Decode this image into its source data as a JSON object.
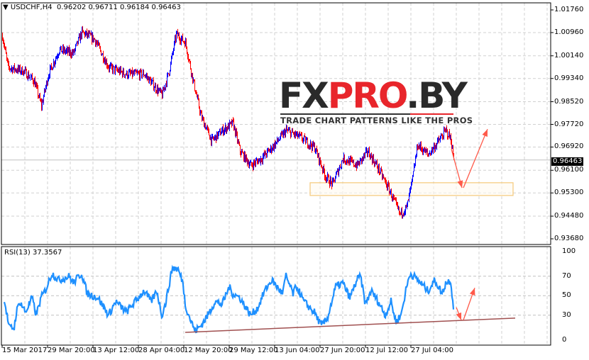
{
  "header": {
    "symbol": "USDCHF,H4",
    "ohlc": "0.96202 0.96711 0.96184 0.96463",
    "menu_icon": "triangle-down-icon"
  },
  "price_axis": {
    "labels": [
      "1.01760",
      "1.00960",
      "1.00140",
      "0.99340",
      "0.98520",
      "0.97720",
      "0.96920",
      "0.96100",
      "0.95300",
      "0.94480",
      "0.93680"
    ],
    "current": "0.96463"
  },
  "rsi": {
    "title": "RSI(13) 37.3567",
    "labels": [
      "100",
      "70",
      "50",
      "30",
      "0"
    ]
  },
  "time_axis": {
    "labels": [
      "15 Mar 2017",
      "29 Mar 20:00",
      "13 Apr 12:00",
      "28 Apr 04:00",
      "12 May 20:00",
      "29 May 12:00",
      "13 Jun 04:00",
      "27 Jun 20:00",
      "12 Jul 12:00",
      "27 Jul 04:00"
    ]
  },
  "logo": {
    "part1": "FX",
    "part2": "PRO",
    "part3": ".BY",
    "tagline": "TRADE CHART PATTERNS LIKE THE PROS"
  },
  "colors": {
    "up": "#0000ff",
    "down": "#ff0000",
    "rsi": "#1e90ff",
    "trend": "#a05050",
    "arrow": "#ff5a4a",
    "zone": "#f5c97a"
  },
  "chart_data": {
    "type": "line",
    "price": {
      "ylim": [
        0.9368,
        1.0176
      ],
      "last": 0.96463,
      "keypoints": [
        [
          0,
          1.0085
        ],
        [
          8,
          0.9973
        ],
        [
          30,
          0.996
        ],
        [
          45,
          0.9924
        ],
        [
          55,
          0.9837
        ],
        [
          65,
          0.9949
        ],
        [
          80,
          1.0035
        ],
        [
          100,
          1.0023
        ],
        [
          112,
          1.0097
        ],
        [
          130,
          1.0072
        ],
        [
          150,
          0.9973
        ],
        [
          175,
          0.9949
        ],
        [
          200,
          0.9949
        ],
        [
          225,
          0.9875
        ],
        [
          235,
          0.996
        ],
        [
          245,
          1.009
        ],
        [
          258,
          1.006
        ],
        [
          268,
          0.9936
        ],
        [
          280,
          0.98
        ],
        [
          295,
          0.9714
        ],
        [
          310,
          0.975
        ],
        [
          325,
          0.9776
        ],
        [
          335,
          0.9677
        ],
        [
          350,
          0.9627
        ],
        [
          365,
          0.9652
        ],
        [
          380,
          0.969
        ],
        [
          400,
          0.975
        ],
        [
          420,
          0.9726
        ],
        [
          440,
          0.969
        ],
        [
          455,
          0.959
        ],
        [
          465,
          0.956
        ],
        [
          480,
          0.9652
        ],
        [
          500,
          0.9627
        ],
        [
          515,
          0.9677
        ],
        [
          530,
          0.9615
        ],
        [
          545,
          0.9541
        ],
        [
          560,
          0.9455
        ],
        [
          570,
          0.948
        ],
        [
          578,
          0.958
        ],
        [
          585,
          0.97
        ],
        [
          600,
          0.9665
        ],
        [
          615,
          0.9714
        ],
        [
          625,
          0.975
        ],
        [
          632,
          0.972
        ],
        [
          636,
          0.96463
        ]
      ],
      "zone": [
        0.9521,
        0.9566
      ],
      "arrows": [
        [
          [
            633,
            0.9685
          ],
          [
            648,
            0.9548
          ]
        ],
        [
          [
            650,
            0.9548
          ],
          [
            684,
            0.9755
          ]
        ]
      ]
    },
    "rsi": {
      "ylim": [
        0,
        100
      ],
      "levels": [
        30,
        50,
        70
      ],
      "keypoints": [
        [
          3,
          46
        ],
        [
          10,
          17
        ],
        [
          17,
          17
        ],
        [
          20,
          33
        ],
        [
          25,
          44
        ],
        [
          33,
          33
        ],
        [
          42,
          48
        ],
        [
          48,
          30
        ],
        [
          55,
          48
        ],
        [
          62,
          57
        ],
        [
          70,
          73
        ],
        [
          80,
          66
        ],
        [
          95,
          70
        ],
        [
          100,
          63
        ],
        [
          112,
          73
        ],
        [
          120,
          52
        ],
        [
          135,
          48
        ],
        [
          150,
          30
        ],
        [
          160,
          44
        ],
        [
          175,
          33
        ],
        [
          200,
          55
        ],
        [
          210,
          44
        ],
        [
          218,
          55
        ],
        [
          225,
          30
        ],
        [
          230,
          41
        ],
        [
          240,
          79
        ],
        [
          248,
          77
        ],
        [
          255,
          63
        ],
        [
          258,
          41
        ],
        [
          265,
          26
        ],
        [
          272,
          14
        ],
        [
          280,
          19
        ],
        [
          290,
          30
        ],
        [
          300,
          44
        ],
        [
          310,
          41
        ],
        [
          320,
          59
        ],
        [
          325,
          52
        ],
        [
          335,
          48
        ],
        [
          350,
          30
        ],
        [
          360,
          37
        ],
        [
          370,
          55
        ],
        [
          380,
          66
        ],
        [
          395,
          52
        ],
        [
          400,
          70
        ],
        [
          410,
          52
        ],
        [
          415,
          60
        ],
        [
          425,
          44
        ],
        [
          440,
          33
        ],
        [
          450,
          19
        ],
        [
          458,
          26
        ],
        [
          470,
          59
        ],
        [
          480,
          63
        ],
        [
          490,
          48
        ],
        [
          500,
          66
        ],
        [
          505,
          70
        ],
        [
          512,
          41
        ],
        [
          520,
          55
        ],
        [
          530,
          44
        ],
        [
          540,
          30
        ],
        [
          548,
          44
        ],
        [
          555,
          23
        ],
        [
          562,
          30
        ],
        [
          570,
          59
        ],
        [
          575,
          73
        ],
        [
          580,
          70
        ],
        [
          590,
          63
        ],
        [
          600,
          55
        ],
        [
          610,
          66
        ],
        [
          620,
          52
        ],
        [
          625,
          63
        ],
        [
          632,
          66
        ],
        [
          636,
          37.36
        ]
      ],
      "trendline": [
        [
          258,
          12.4
        ],
        [
          723,
          27
        ]
      ],
      "arrows": [
        [
          [
            640,
            38
          ],
          [
            647,
            25
          ]
        ],
        [
          [
            650,
            25
          ],
          [
            666,
            58
          ]
        ]
      ]
    }
  }
}
